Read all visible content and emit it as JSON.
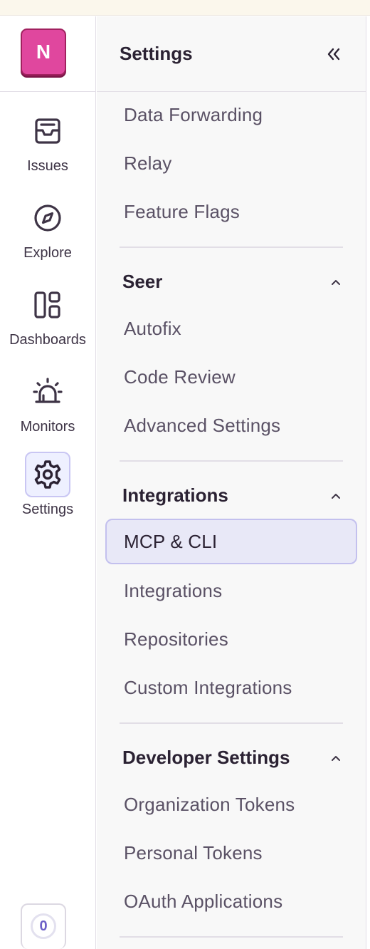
{
  "org": {
    "initial": "N",
    "color": "#e0479e"
  },
  "rail": {
    "items": [
      {
        "label": "Issues",
        "icon": "inbox-icon"
      },
      {
        "label": "Explore",
        "icon": "compass-icon"
      },
      {
        "label": "Dashboards",
        "icon": "dashboard-icon"
      },
      {
        "label": "Monitors",
        "icon": "siren-icon"
      },
      {
        "label": "Settings",
        "icon": "gear-icon",
        "active": true
      }
    ],
    "badge_count": "0"
  },
  "panel": {
    "title": "Settings",
    "top_items": [
      "Data Forwarding",
      "Relay",
      "Feature Flags"
    ],
    "sections": [
      {
        "title": "Seer",
        "items": [
          "Autofix",
          "Code Review",
          "Advanced Settings"
        ]
      },
      {
        "title": "Integrations",
        "items": [
          "MCP & CLI",
          "Integrations",
          "Repositories",
          "Custom Integrations"
        ],
        "active_item": "MCP & CLI"
      },
      {
        "title": "Developer Settings",
        "items": [
          "Organization Tokens",
          "Personal Tokens",
          "OAuth Applications"
        ]
      }
    ]
  },
  "colors": {
    "accent": "#6c5fc7",
    "active_bg": "#e8e8f7",
    "active_border": "#c3c0ee"
  }
}
